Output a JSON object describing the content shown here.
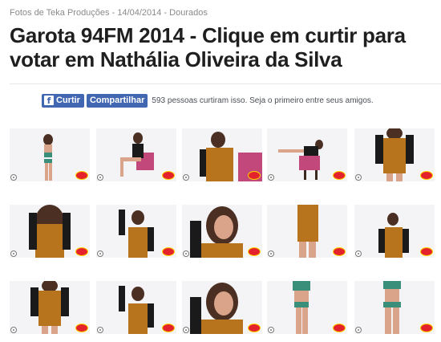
{
  "article": {
    "meta": "Fotos de Teka Produções - 14/04/2014 - Dourados",
    "title": "Garota 94FM 2014 - Clique em curtir para votar em Nathália Oliveira da Silva"
  },
  "social": {
    "like_label": "Curtir",
    "share_label": "Compartilhar",
    "count_text": "593 pessoas curtiram isso. Seja o primeiro entre seus amigos.",
    "fb_logo": "f"
  },
  "gallery": {
    "photos": [
      {
        "pose": "standing-bikini"
      },
      {
        "pose": "seated-pink-chair"
      },
      {
        "pose": "seated-closeup"
      },
      {
        "pose": "reclining-chair"
      },
      {
        "pose": "torso-leopard"
      },
      {
        "pose": "torso-hair"
      },
      {
        "pose": "arm-raised"
      },
      {
        "pose": "face-closeup"
      },
      {
        "pose": "side-leopard"
      },
      {
        "pose": "standing-leopard"
      },
      {
        "pose": "torso-leopard"
      },
      {
        "pose": "arm-raised"
      },
      {
        "pose": "face-closeup"
      },
      {
        "pose": "bikini-side"
      },
      {
        "pose": "bikini-back"
      }
    ]
  },
  "colors": {
    "facebook_blue": "#4267b2",
    "title": "#1f1f1f",
    "meta": "#8a8a8a",
    "leopard": "#b8741c",
    "hair": "#4a2f22",
    "skin": "#d9a48a"
  }
}
